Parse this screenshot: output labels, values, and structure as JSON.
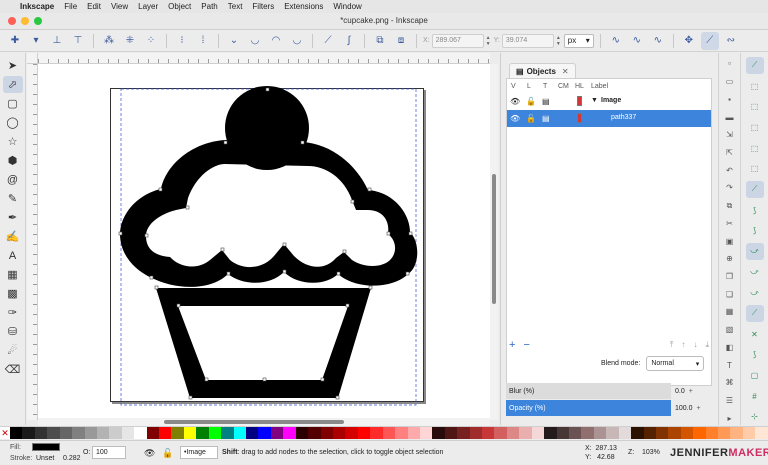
{
  "menubar": {
    "app": "Inkscape",
    "items": [
      "File",
      "Edit",
      "View",
      "Layer",
      "Object",
      "Path",
      "Text",
      "Filters",
      "Extensions",
      "Window"
    ]
  },
  "window": {
    "title": "*cupcake.png - Inkscape"
  },
  "toolbar": {
    "x_label": "X:",
    "x_value": "289.067",
    "y_label": "Y:",
    "y_value": "39.074",
    "unit": "px"
  },
  "objects_dialog": {
    "tab_label": "Objects",
    "columns": [
      "V",
      "L",
      "T",
      "CM",
      "HL",
      "Label"
    ],
    "rows": [
      {
        "label": "Image",
        "selected": false
      },
      {
        "label": "path337",
        "selected": true
      }
    ],
    "blend_label": "Blend mode:",
    "blend_value": "Normal",
    "blur_label": "Blur (%)",
    "blur_value": "0.0",
    "opacity_label": "Opacity (%)",
    "opacity_value": "100.0"
  },
  "palette": {
    "colors": [
      "#000000",
      "#1a1a1a",
      "#333333",
      "#4d4d4d",
      "#666666",
      "#808080",
      "#999999",
      "#b3b3b3",
      "#cccccc",
      "#e6e6e6",
      "#ffffff",
      "#800000",
      "#ff0000",
      "#808000",
      "#ffff00",
      "#008000",
      "#00ff00",
      "#008080",
      "#00ffff",
      "#000080",
      "#0000ff",
      "#800080",
      "#ff00ff",
      "#2b0000",
      "#550000",
      "#800000",
      "#aa0000",
      "#d40000",
      "#ff0000",
      "#ff2a2a",
      "#ff5555",
      "#ff8080",
      "#ffaaaa",
      "#ffd5d5",
      "#280b0b",
      "#501616",
      "#782121",
      "#a02c2c",
      "#c83737",
      "#d35f5f",
      "#de8787",
      "#e9afaf",
      "#f4d7d7",
      "#241c1c",
      "#483737",
      "#6c5353",
      "#916f6f",
      "#ac9393",
      "#c8b7b7",
      "#e3dbdb",
      "#2b1100",
      "#552200",
      "#803300",
      "#aa4400",
      "#d45500",
      "#ff6600",
      "#ff7f2a",
      "#ff9955",
      "#ffb380",
      "#ffccaa",
      "#ffe6d5"
    ]
  },
  "status": {
    "fill_label": "Fill:",
    "stroke_label": "Stroke:",
    "stroke_value": "Unset",
    "stroke_width": "0.282",
    "opacity_label": "O:",
    "opacity_value": "100",
    "layer": "•Image",
    "message_bold": "Shift",
    "message": ": drag to add nodes to the selection, click to toggle object selection",
    "x_label": "X:",
    "x_value": "287.13",
    "y_label": "Y:",
    "y_value": "42.68",
    "zoom_label": "Z:",
    "zoom_value": "103%"
  },
  "brand": {
    "part1": "JENNIFER",
    "part2": "MAKER"
  }
}
